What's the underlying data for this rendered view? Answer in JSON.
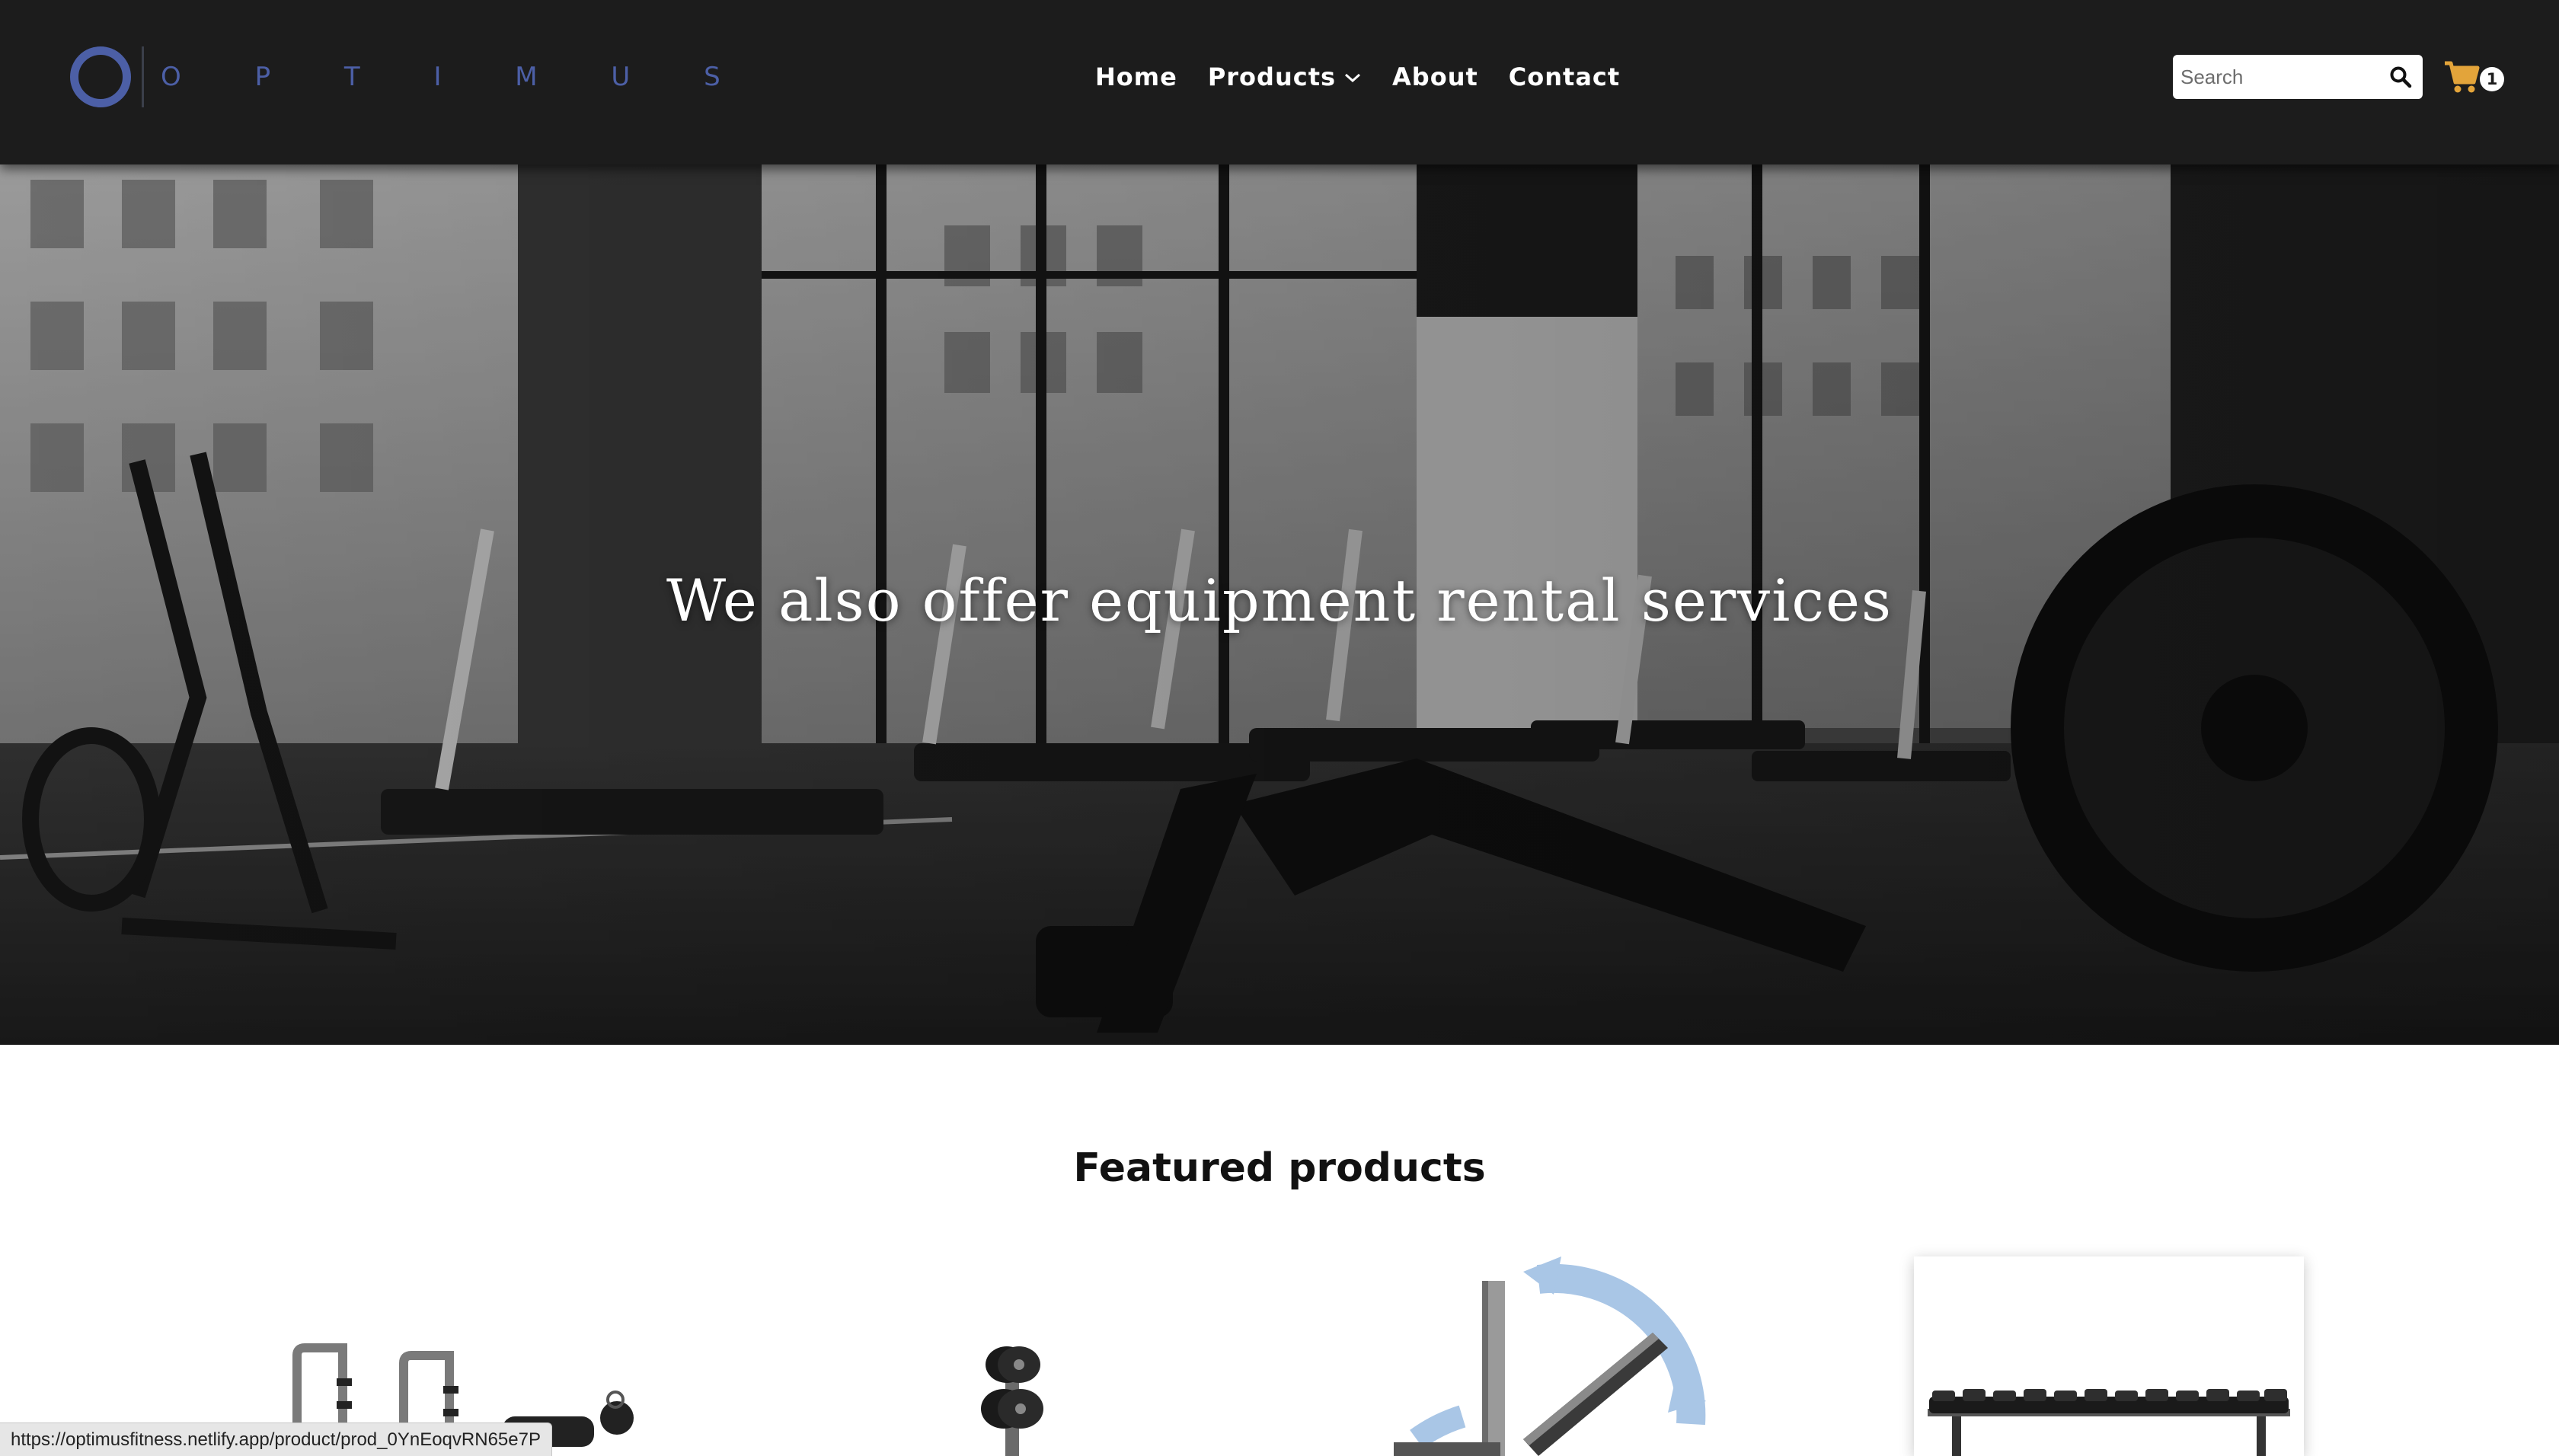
{
  "brand": {
    "name": "O P T I M U S",
    "accent_color": "#4c5fa6"
  },
  "nav": {
    "home": "Home",
    "products": "Products",
    "about": "About",
    "contact": "Contact"
  },
  "search": {
    "placeholder": "Search",
    "icon": "magnifier-icon"
  },
  "cart": {
    "count": "1",
    "icon": "shopping-cart-icon",
    "icon_color": "#e3a43a"
  },
  "hero": {
    "title": "We also offer equipment rental services"
  },
  "featured": {
    "title": "Featured products",
    "products": [
      {
        "icon": "weight-machine-image"
      },
      {
        "icon": "plate-tree-image"
      },
      {
        "icon": "adjustable-bench-image"
      },
      {
        "icon": "dumbbell-rack-image"
      }
    ]
  },
  "status_bar": {
    "url": "https://optimusfitness.netlify.app/product/prod_0YnEoqvRN65e7P"
  }
}
